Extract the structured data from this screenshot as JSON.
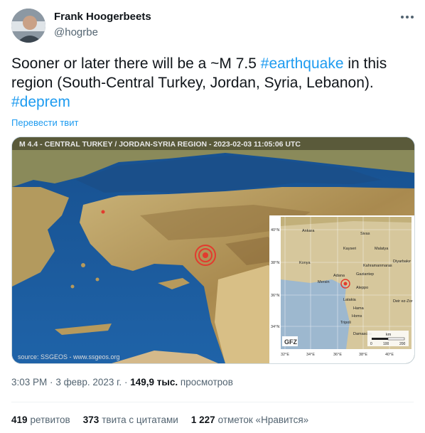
{
  "author": {
    "name": "Frank Hoogerbeets",
    "handle": "@hogrbe"
  },
  "tweet": {
    "text_1": "Sooner or later there will be a ~M 7.5 ",
    "hashtag_1": "#earthquake",
    "text_2": " in this region (South-Central Turkey, Jordan, Syria, Lebanon). ",
    "hashtag_2": "#deprem",
    "translate_label": "Перевести твит"
  },
  "media": {
    "map_title": "M 4.4 - CENTRAL TURKEY / JORDAN-SYRIA REGION - 2023-02-03 11:05:06 UTC",
    "source": "source: SSGEOS - www.ssgeos.org",
    "inset_logo": "GFZ",
    "inset_cities": [
      "Ankara",
      "Sivas",
      "Kayseri",
      "Malatya",
      "Diyarbakır",
      "Konya",
      "Kahramanmaras",
      "Adana",
      "Gaziantep",
      "Mersin",
      "Aleppo",
      "Latakia",
      "Hama",
      "Homs",
      "Tripoli",
      "Damascus",
      "Deir ez-Zor"
    ],
    "inset_lat_labels": [
      "40°N",
      "38°N",
      "36°N",
      "34°N"
    ],
    "inset_lon_labels": [
      "32°E",
      "34°E",
      "36°E",
      "38°E",
      "40°E"
    ],
    "scale_unit": "km",
    "scale_ticks": [
      "0",
      "100",
      "200"
    ],
    "colors": {
      "sea": "#1f5fa3",
      "land": "#b79a5c",
      "highland": "#8a6a3a",
      "epicenter": "#e23b2e"
    }
  },
  "meta": {
    "time": "3:03 PM",
    "separator": "·",
    "date": "3 февр. 2023 г.",
    "views_count": "149,9 тыс.",
    "views_label": "просмотров"
  },
  "stats": {
    "retweets_count": "419",
    "retweets_label": "ретвитов",
    "quotes_count": "373",
    "quotes_label": "твита с цитатами",
    "likes_count": "1 227",
    "likes_label": "отметок «Нравится»"
  },
  "icons": {
    "more": "more-dots-icon"
  }
}
